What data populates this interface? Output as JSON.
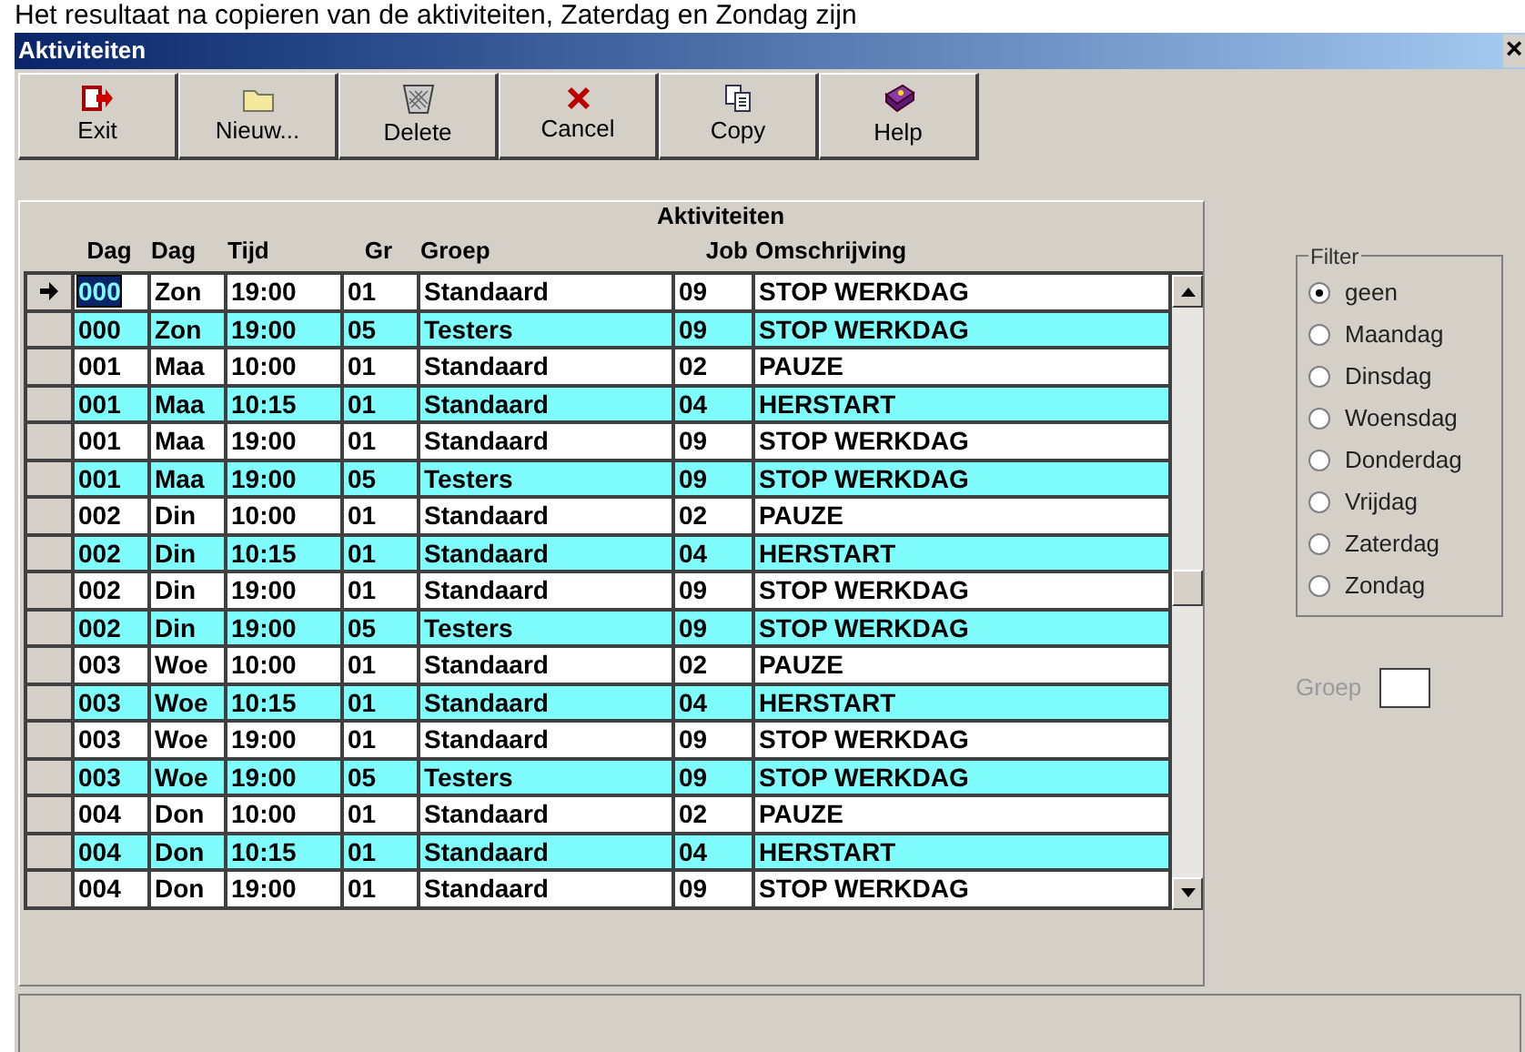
{
  "caption": "Het resultaat na copieren van de aktiviteiten, Zaterdag en Zondag zijn",
  "window": {
    "title": "Aktiviteiten",
    "close": "×"
  },
  "toolbar": [
    {
      "label": "Exit",
      "kind": "exit"
    },
    {
      "label": "Nieuw...",
      "kind": "new"
    },
    {
      "label": "Delete",
      "kind": "delete"
    },
    {
      "label": "Cancel",
      "kind": "cancel"
    },
    {
      "label": "Copy",
      "kind": "copy"
    },
    {
      "label": "Help",
      "kind": "help"
    }
  ],
  "table": {
    "title": "Aktiviteiten",
    "columns": [
      "Dag",
      "Dag",
      "Tijd",
      "Gr",
      "Groep",
      "Job",
      "Omschrijving"
    ],
    "rows": [
      {
        "selected": true,
        "highlighted": false,
        "cells": [
          "000",
          "Zon",
          "19:00",
          "01",
          "Standaard",
          "09",
          "STOP WERKDAG"
        ]
      },
      {
        "selected": false,
        "highlighted": true,
        "cells": [
          "000",
          "Zon",
          "19:00",
          "05",
          "Testers",
          "09",
          "STOP WERKDAG"
        ]
      },
      {
        "selected": false,
        "highlighted": false,
        "cells": [
          "001",
          "Maa",
          "10:00",
          "01",
          "Standaard",
          "02",
          "PAUZE"
        ]
      },
      {
        "selected": false,
        "highlighted": true,
        "cells": [
          "001",
          "Maa",
          "10:15",
          "01",
          "Standaard",
          "04",
          "HERSTART"
        ]
      },
      {
        "selected": false,
        "highlighted": false,
        "cells": [
          "001",
          "Maa",
          "19:00",
          "01",
          "Standaard",
          "09",
          "STOP WERKDAG"
        ]
      },
      {
        "selected": false,
        "highlighted": true,
        "cells": [
          "001",
          "Maa",
          "19:00",
          "05",
          "Testers",
          "09",
          "STOP WERKDAG"
        ]
      },
      {
        "selected": false,
        "highlighted": false,
        "cells": [
          "002",
          "Din",
          "10:00",
          "01",
          "Standaard",
          "02",
          "PAUZE"
        ]
      },
      {
        "selected": false,
        "highlighted": true,
        "cells": [
          "002",
          "Din",
          "10:15",
          "01",
          "Standaard",
          "04",
          "HERSTART"
        ]
      },
      {
        "selected": false,
        "highlighted": false,
        "cells": [
          "002",
          "Din",
          "19:00",
          "01",
          "Standaard",
          "09",
          "STOP WERKDAG"
        ]
      },
      {
        "selected": false,
        "highlighted": true,
        "cells": [
          "002",
          "Din",
          "19:00",
          "05",
          "Testers",
          "09",
          "STOP WERKDAG"
        ]
      },
      {
        "selected": false,
        "highlighted": false,
        "cells": [
          "003",
          "Woe",
          "10:00",
          "01",
          "Standaard",
          "02",
          "PAUZE"
        ]
      },
      {
        "selected": false,
        "highlighted": true,
        "cells": [
          "003",
          "Woe",
          "10:15",
          "01",
          "Standaard",
          "04",
          "HERSTART"
        ]
      },
      {
        "selected": false,
        "highlighted": false,
        "cells": [
          "003",
          "Woe",
          "19:00",
          "01",
          "Standaard",
          "09",
          "STOP WERKDAG"
        ]
      },
      {
        "selected": false,
        "highlighted": true,
        "cells": [
          "003",
          "Woe",
          "19:00",
          "05",
          "Testers",
          "09",
          "STOP WERKDAG"
        ]
      },
      {
        "selected": false,
        "highlighted": false,
        "cells": [
          "004",
          "Don",
          "10:00",
          "01",
          "Standaard",
          "02",
          "PAUZE"
        ]
      },
      {
        "selected": false,
        "highlighted": true,
        "cells": [
          "004",
          "Don",
          "10:15",
          "01",
          "Standaard",
          "04",
          "HERSTART"
        ]
      },
      {
        "selected": false,
        "highlighted": false,
        "cells": [
          "004",
          "Don",
          "19:00",
          "01",
          "Standaard",
          "09",
          "STOP WERKDAG"
        ]
      }
    ]
  },
  "filter": {
    "title": "Filter",
    "options": [
      {
        "label": "geen",
        "selected": true
      },
      {
        "label": "Maandag",
        "selected": false
      },
      {
        "label": "Dinsdag",
        "selected": false
      },
      {
        "label": "Woensdag",
        "selected": false
      },
      {
        "label": "Donderdag",
        "selected": false
      },
      {
        "label": "Vrijdag",
        "selected": false
      },
      {
        "label": "Zaterdag",
        "selected": false
      },
      {
        "label": "Zondag",
        "selected": false
      }
    ]
  },
  "groep": {
    "label": "Groep",
    "disabled": true
  }
}
